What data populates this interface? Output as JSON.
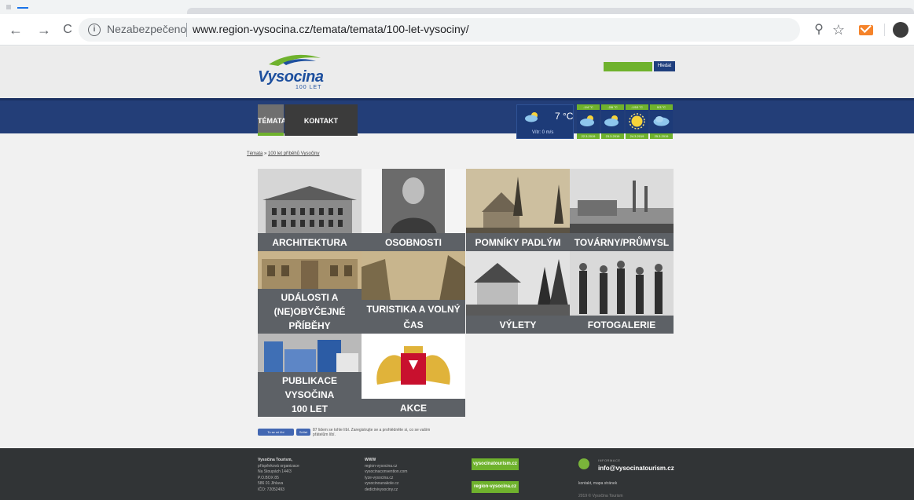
{
  "browser": {
    "secure_label": "Nezabezpečeno",
    "url": "www.region-vysocina.cz/temata/temata/100-let-vysociny/",
    "back_icon": "←",
    "forward_icon": "→",
    "reload_icon": "C",
    "zoom_icon": "⚲",
    "star_icon": "☆"
  },
  "header": {
    "logo_text": "Vysocina",
    "logo_sub": "100 LET",
    "search_button": "Hledat"
  },
  "nav": {
    "items": [
      "TÉMATA",
      "KONTAKT"
    ]
  },
  "weather": {
    "temp": "7 °C",
    "wind": "Vítr:  0 m/s",
    "forecast": [
      {
        "top": "-1/4 °C",
        "date": "22.3.2019",
        "icon": "cloud-sun"
      },
      {
        "top": "-2/6 °C",
        "date": "23.3.2019",
        "icon": "cloud-sun"
      },
      {
        "top": "-1/10 °C",
        "date": "24.3.2019",
        "icon": "sun"
      },
      {
        "top": "0/3 °C",
        "date": "25.3.2019",
        "icon": "cloud"
      }
    ]
  },
  "breadcrumb": {
    "parent": "Témata",
    "separator": " » ",
    "current": "100 let příběhů Vysočiny"
  },
  "tiles": [
    {
      "label": "ARCHITEKTURA"
    },
    {
      "label": "OSOBNOSTI"
    },
    {
      "label": "POMNÍKY PADLÝM"
    },
    {
      "label": "TOVÁRNY/PRŮMYSL"
    },
    {
      "label_1": "UDÁLOSTI A",
      "label_2": "(NE)OBYČEJNÉ PŘÍBĚHY"
    },
    {
      "label": "TURISTIKA A VOLNÝ ČAS"
    },
    {
      "label": "VÝLETY"
    },
    {
      "label": "FOTOGALERIE"
    },
    {
      "label_1": "PUBLIKACE VYSOČINA",
      "label_2": "100 LET"
    },
    {
      "label": "AKCE"
    }
  ],
  "facebook": {
    "like": "To se mi líbí",
    "share": "Sdílet",
    "text": "87 lidem se tohle líbí. Zaregistrujte se a prohlédněte si, co se vašim přátelům líbí."
  },
  "footer": {
    "org": [
      "Vysočina Tourism,",
      "příspěvková organizace",
      "Na Stoupách 144/3",
      "P.O.BOX 85",
      "586 01 Jihlava",
      "IČO: 72052493"
    ],
    "www_head": "WWW",
    "www": [
      "region-vysocina.cz",
      "vysocinaconvention.com",
      "lyze-vysocina.cz",
      "vysocinounakole.cz",
      "dedictvivysociny.cz"
    ],
    "btn1": "vysocinatourism.cz",
    "btn2": "region-vysocina.cz",
    "info_label": "INFORMACE",
    "info_mail": "info@vysocinatourism.cz",
    "links": "kontakt, mapa stránek",
    "copy": "2019 © Vysočina Tourism"
  }
}
